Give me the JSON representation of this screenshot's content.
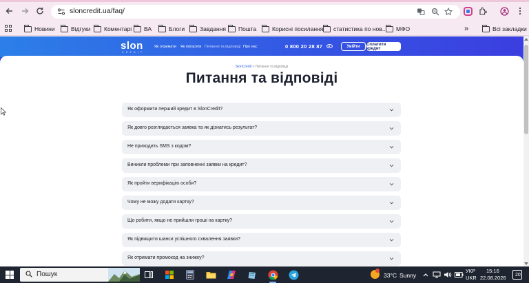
{
  "browser": {
    "url": "sloncredit.ua/faq/",
    "bookmarks": [
      {
        "label": "Новини"
      },
      {
        "label": "Відгуки"
      },
      {
        "label": "Коментарі"
      },
      {
        "label": "ВА"
      },
      {
        "label": "Блоги"
      },
      {
        "label": "Завдання"
      },
      {
        "label": "Пошта"
      },
      {
        "label": "Корисні посилання"
      },
      {
        "label": "статистика по нов..."
      },
      {
        "label": "МФО"
      }
    ],
    "more_bookmarks": "»",
    "all_bookmarks": "Всі закладки"
  },
  "site": {
    "logo": {
      "word": "slon",
      "sub": "CREDIT"
    },
    "nav": [
      {
        "label": "Як отримати"
      },
      {
        "label": "Як погасити"
      },
      {
        "label": "Питання та відповіді"
      },
      {
        "label": "Про нас"
      }
    ],
    "phone": "0 800 20 28 87",
    "login_label": "Увійти",
    "pay_label": "Сплатити кредит"
  },
  "page": {
    "breadcrumb_home": "SlonCredit",
    "breadcrumb_sep": ">",
    "breadcrumb_current": "Питання та відповіді",
    "title": "Питання та відповіді"
  },
  "faq": [
    {
      "question": "Як оформити перший кредит в SlonCredit?"
    },
    {
      "question": "Як довго розглядається заявка та як дізнатись результат?"
    },
    {
      "question": "Не приходить SMS з кодом?"
    },
    {
      "question": "Виникли проблеми при заповненні заявки на кредит?"
    },
    {
      "question": "Як пройти верифікацію особи?"
    },
    {
      "question": "Чому не можу додати картку?"
    },
    {
      "question": "Що робити, якщо не прийшли гроші на картку?"
    },
    {
      "question": "Як підвищити шанси успішного схвалення заявки?"
    },
    {
      "question": "Як отримати промокод на знижку?"
    }
  ],
  "taskbar": {
    "search_placeholder": "Пошук",
    "weather_temp": "33°C",
    "weather_desc": "Sunny",
    "lang_top": "УКР",
    "lang_bottom": "UKR",
    "time": "15:16",
    "date": "22.08.2026",
    "notifications": "20"
  },
  "colors": {
    "header_start": "#2c7fe8",
    "header_end": "#3b3ee0",
    "faq_bg": "#eef0f4",
    "title": "#1e2130",
    "taskbar": "#1f2530"
  }
}
